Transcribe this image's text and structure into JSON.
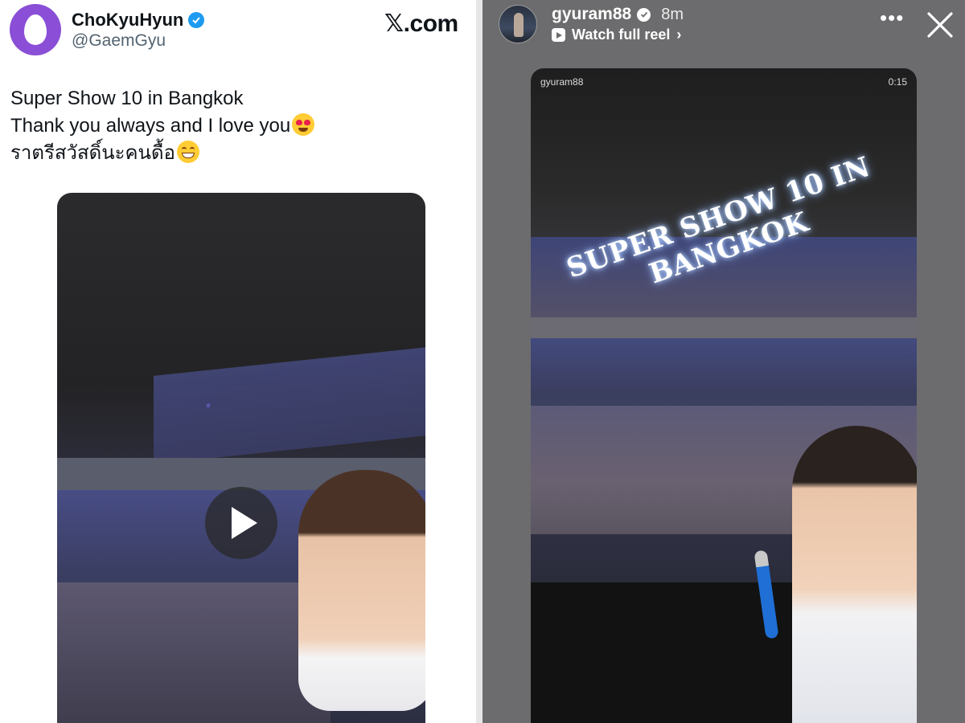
{
  "tweet": {
    "display_name": "ChoKyuHyun",
    "handle": "@GaemGyu",
    "site_label": "𝕏.com",
    "text_lines": [
      "Super Show 10 in Bangkok",
      "Thank you always and I love you",
      "ราตรีสวัสดิ์นะคนดื้อ"
    ],
    "emojis": [
      "smiling-face-with-heart-eyes",
      "grinning-face-with-smiling-eyes"
    ],
    "avatar_color": "#8a4fd6",
    "verified_color": "#1d9bf0"
  },
  "story": {
    "username": "gyuram88",
    "time_ago": "8m",
    "reel_link": "Watch full reel",
    "reel_chevron": "›",
    "more_label": "•••",
    "video_username": "gyuram88",
    "video_timestamp": "0:15",
    "overlay_text": "SUPER SHOW 10 IN BANGKOK",
    "background_color": "#6c6c6e"
  }
}
